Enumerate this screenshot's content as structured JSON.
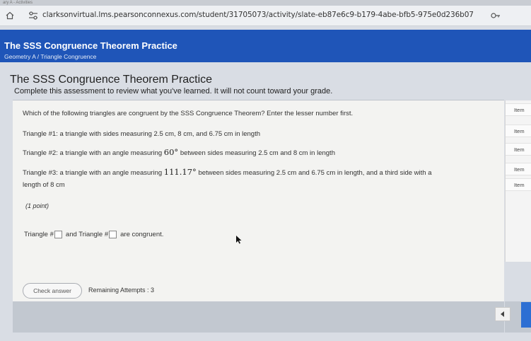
{
  "browser": {
    "tab_fragment": "ary A - Activities",
    "url": "clarksonvirtual.lms.pearsonconnexus.com/student/31705073/activity/slate-eb87e6c9-b179-4abe-bfb5-975e0d236b07"
  },
  "header": {
    "title": "The SSS Congruence Theorem Practice",
    "breadcrumb": "Geometry A / Triangle Congruence"
  },
  "content": {
    "title": "The SSS Congruence Theorem Practice",
    "subtitle": "Complete this assessment to review what you've learned. It will not count toward your grade."
  },
  "question": {
    "prompt": "Which of the following triangles are congruent by the SSS Congruence Theorem? Enter the lesser number first.",
    "t1": "Triangle #1: a triangle with sides measuring 2.5 cm, 8 cm, and 6.75 cm in length",
    "t2_before": "Triangle #2: a triangle with an angle measuring",
    "t2_value": "60°",
    "t2_after": "between sides measuring 2.5 cm and 8 cm in length",
    "t3_before": "Triangle #3: a triangle with an angle measuring",
    "t3_value": "111.17°",
    "t3_after": "between sides measuring 2.5 cm and 6.75 cm in length, and a third side with a",
    "t3_line2": "length of 8 cm",
    "points": "(1 point)",
    "answer_part1": "Triangle #",
    "answer_part2": "and Triangle #",
    "answer_part3": "are congruent.",
    "answer_value_1": "",
    "answer_value_2": ""
  },
  "actions": {
    "check_label": "Check answer",
    "attempts": "Remaining Attempts : 3"
  },
  "sidebar": {
    "items": [
      "Item",
      "Item",
      "Item",
      "Item",
      "Item"
    ]
  },
  "colors": {
    "header": "#1f55b8",
    "accent": "#2d6fd3"
  }
}
